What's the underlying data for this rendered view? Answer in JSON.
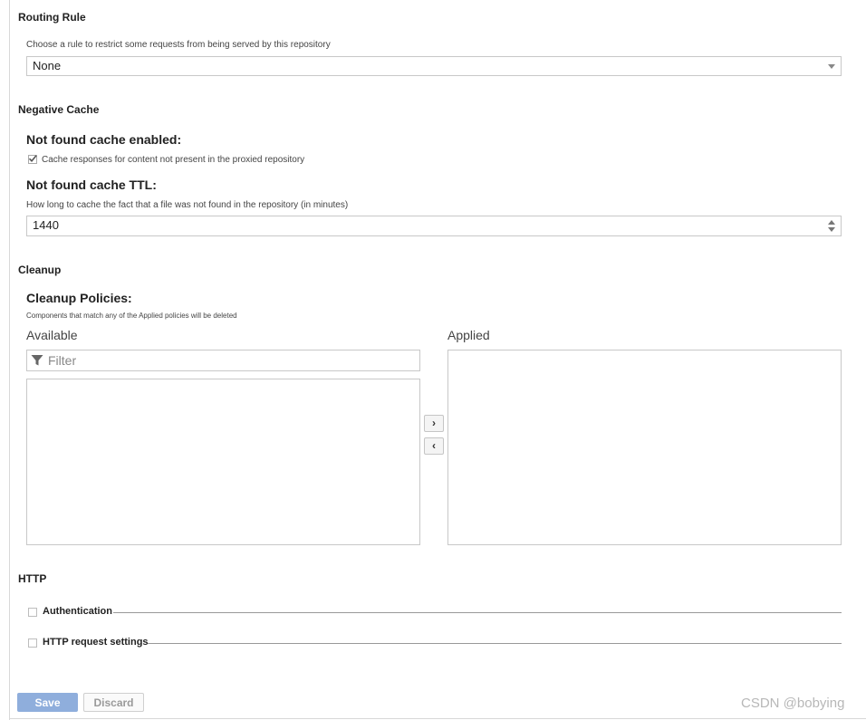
{
  "routing": {
    "title": "Routing Rule",
    "help": "Choose a rule to restrict some requests from being served by this repository",
    "selected": "None"
  },
  "negative_cache": {
    "title": "Negative Cache",
    "enabled_label": "Not found cache enabled:",
    "enabled_checkbox_label": "Cache responses for content not present in the proxied repository",
    "enabled_checked": true,
    "ttl_label": "Not found cache TTL:",
    "ttl_help": "How long to cache the fact that a file was not found in the repository (in minutes)",
    "ttl_value": "1440"
  },
  "cleanup": {
    "title": "Cleanup",
    "policies_label": "Cleanup Policies:",
    "policies_help": "Components that match any of the Applied policies will be deleted",
    "available_label": "Available",
    "applied_label": "Applied",
    "filter_placeholder": "Filter",
    "move_right": "›",
    "move_left": "‹"
  },
  "http": {
    "title": "HTTP",
    "authentication_label": "Authentication",
    "request_settings_label": "HTTP request settings"
  },
  "actions": {
    "save_label": "Save",
    "discard_label": "Discard"
  },
  "watermark": "CSDN @bobying",
  "colors": {
    "save_button": "#8faedc",
    "border": "#c8c8c8"
  }
}
